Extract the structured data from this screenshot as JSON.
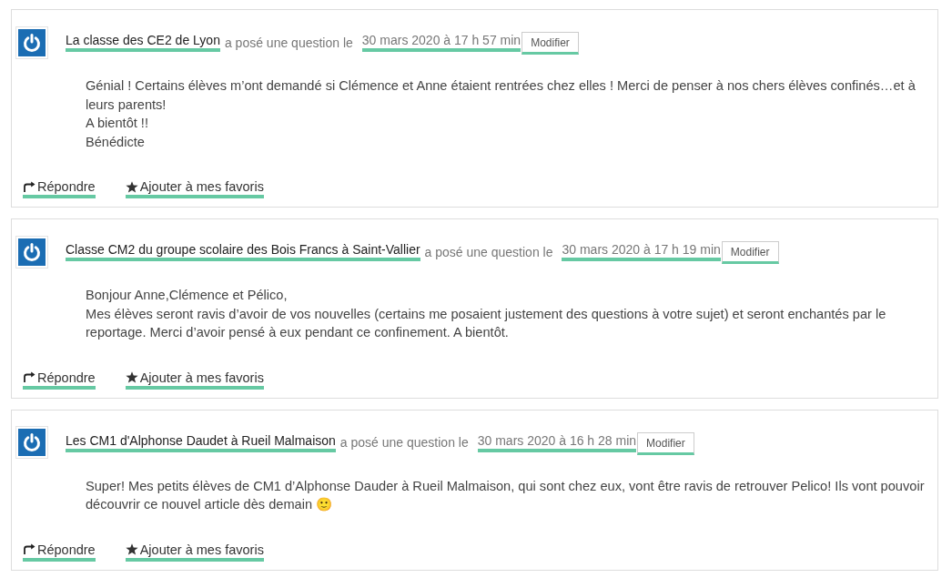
{
  "comments": [
    {
      "author": "La classe des CE2 de Lyon",
      "action_text": "a posé une question le",
      "date": "30 mars 2020 à 17 h 57 min",
      "edit_button": "Modifier",
      "message_lines": [
        "Génial ! Certains élèves m’ont demandé si Clémence et Anne étaient rentrées chez elles ! Merci de penser à nos chers élèves confinés…et à leurs parents!",
        "A bientôt !!",
        "Bénédicte"
      ],
      "actions": [
        {
          "kind": "reply",
          "label": "Répondre"
        },
        {
          "kind": "favorite",
          "label": "Ajouter à mes favoris"
        }
      ]
    },
    {
      "author": "Classe CM2 du groupe scolaire des Bois Francs à Saint-Vallier",
      "action_text": "a posé une question le",
      "date": "30 mars 2020 à 17 h 19 min",
      "edit_button": "Modifier",
      "message_lines": [
        "Bonjour Anne,Clémence et Pélico,",
        "Mes élèves seront ravis d’avoir de vos nouvelles (certains me posaient justement des questions à votre sujet) et seront enchantés par le reportage. Merci d’avoir pensé à eux pendant ce confinement. A bientôt."
      ],
      "actions": [
        {
          "kind": "reply",
          "label": "Répondre"
        },
        {
          "kind": "favorite",
          "label": "Ajouter à mes favoris"
        }
      ]
    },
    {
      "author": "Les CM1 d'Alphonse Daudet à Rueil Malmaison",
      "action_text": "a posé une question le",
      "date": "30 mars 2020 à 16 h 28 min",
      "edit_button": "Modifier",
      "message_lines": [
        "Super! Mes petits élèves de CM1 d’Alphonse Dauder à Rueil Malmaison, qui sont chez eux, vont être ravis de retrouver Pelico! Ils vont pouvoir découvrir ce nouvel article dès demain 🙂"
      ],
      "actions": [
        {
          "kind": "reply",
          "label": "Répondre"
        },
        {
          "kind": "favorite",
          "label": "Ajouter à mes favoris"
        }
      ]
    }
  ]
}
